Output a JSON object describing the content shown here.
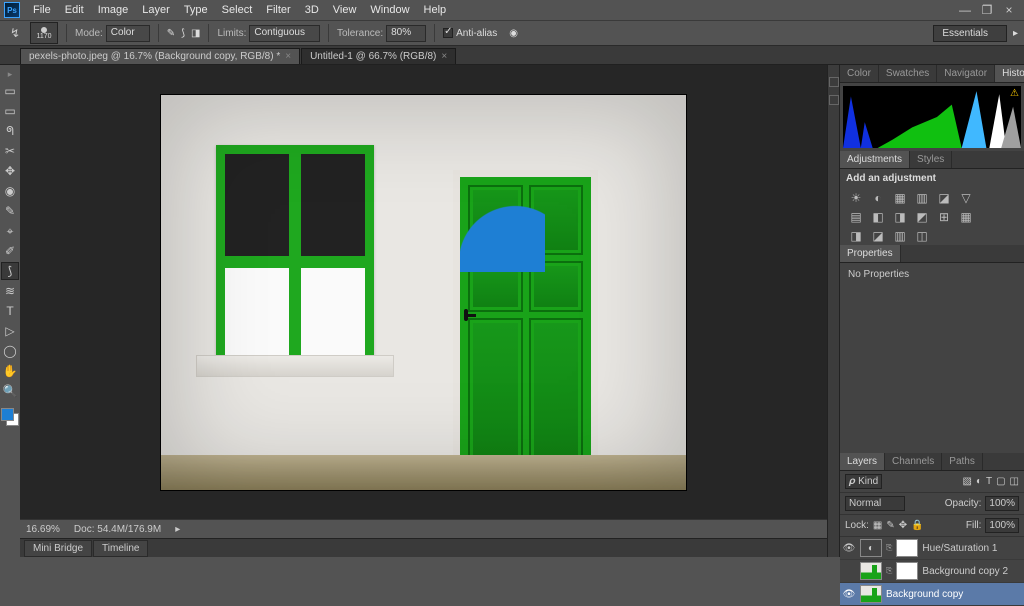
{
  "app": {
    "logo_text": "Ps"
  },
  "menu": {
    "items": [
      "File",
      "Edit",
      "Image",
      "Layer",
      "Type",
      "Select",
      "Filter",
      "3D",
      "View",
      "Window",
      "Help"
    ]
  },
  "win": {
    "min": "—",
    "max": "❐",
    "close": "×"
  },
  "options": {
    "brush_size": "1170",
    "mode_label": "Mode:",
    "mode_value": "Color",
    "limits_label": "Limits:",
    "limits_value": "Contiguous",
    "tolerance_label": "Tolerance:",
    "tolerance_value": "80%",
    "antialias_label": "Anti-alias",
    "workspace": "Essentials"
  },
  "doctabs": [
    {
      "label": "pexels-photo.jpeg @ 16.7% (Background copy, RGB/8) *",
      "active": true
    },
    {
      "label": "Untitled-1 @ 66.7% (RGB/8)",
      "active": false
    }
  ],
  "tools": [
    "▭",
    "▭",
    "ᖗ",
    "✂",
    "✥",
    "◉",
    "✎",
    "⌖",
    "✐",
    "⟆",
    "≋",
    "T",
    "▷",
    "◯",
    "✋",
    "🔍"
  ],
  "colors": {
    "fg": "#1e7fd4"
  },
  "status": {
    "zoom": "16.69%",
    "doc_label": "Doc:",
    "doc_value": "54.4M/176.9M"
  },
  "bottom_tabs": [
    "Mini Bridge",
    "Timeline"
  ],
  "panels": {
    "row1": [
      "Color",
      "Swatches",
      "Navigator",
      "Histogram"
    ],
    "adjustments_tabs": [
      "Adjustments",
      "Styles"
    ],
    "adjustments_title": "Add an adjustment",
    "adj_icons_r1": [
      "☀",
      "◐",
      "▦",
      "▥",
      "◪",
      "▽"
    ],
    "adj_icons_r2": [
      "▤",
      "◧",
      "◨",
      "◩",
      "⊞",
      "▦"
    ],
    "adj_icons_r3": [
      "◨",
      "◪",
      "▥",
      "◫"
    ],
    "properties_tabs": [
      "Properties"
    ],
    "properties_empty": "No Properties",
    "layers_tabs": [
      "Layers",
      "Channels",
      "Paths"
    ],
    "layers_filter": "𝝆 Kind",
    "blend": "Normal",
    "opacity_label": "Opacity:",
    "opacity_value": "100%",
    "lock_label": "Lock:",
    "fill_label": "Fill:",
    "fill_value": "100%",
    "layers": [
      {
        "name": "Hue/Saturation 1",
        "type": "adj"
      },
      {
        "name": "Background copy 2",
        "type": "img"
      },
      {
        "name": "Background copy",
        "type": "img",
        "sel": true
      }
    ]
  }
}
